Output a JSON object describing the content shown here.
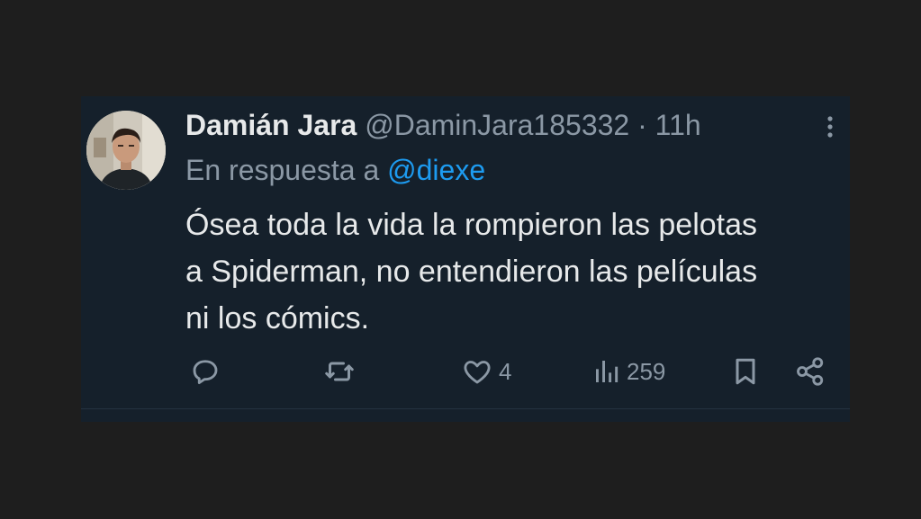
{
  "tweet": {
    "author_name": "Damián Jara",
    "handle": "@DaminJara185332",
    "separator": "·",
    "time": "11h",
    "reply_prefix": "En respuesta a",
    "reply_mention": "@diexe",
    "text": "Ósea toda la vida la rompieron las pelotas\na Spiderman, no entendieron las películas\nni los cómics."
  },
  "actions": {
    "likes": "4",
    "views": "259"
  },
  "icons": {
    "more": "more-vertical-icon",
    "reply": "reply-icon",
    "retweet": "retweet-icon",
    "like": "heart-icon",
    "views": "views-chart-icon",
    "bookmark": "bookmark-icon",
    "share": "share-icon"
  },
  "colors": {
    "card_background": "#15202b",
    "page_background": "#1e1e1e",
    "primary_text": "#e7e9ea",
    "secondary_text": "#8b98a5",
    "accent": "#1d9bf0"
  }
}
